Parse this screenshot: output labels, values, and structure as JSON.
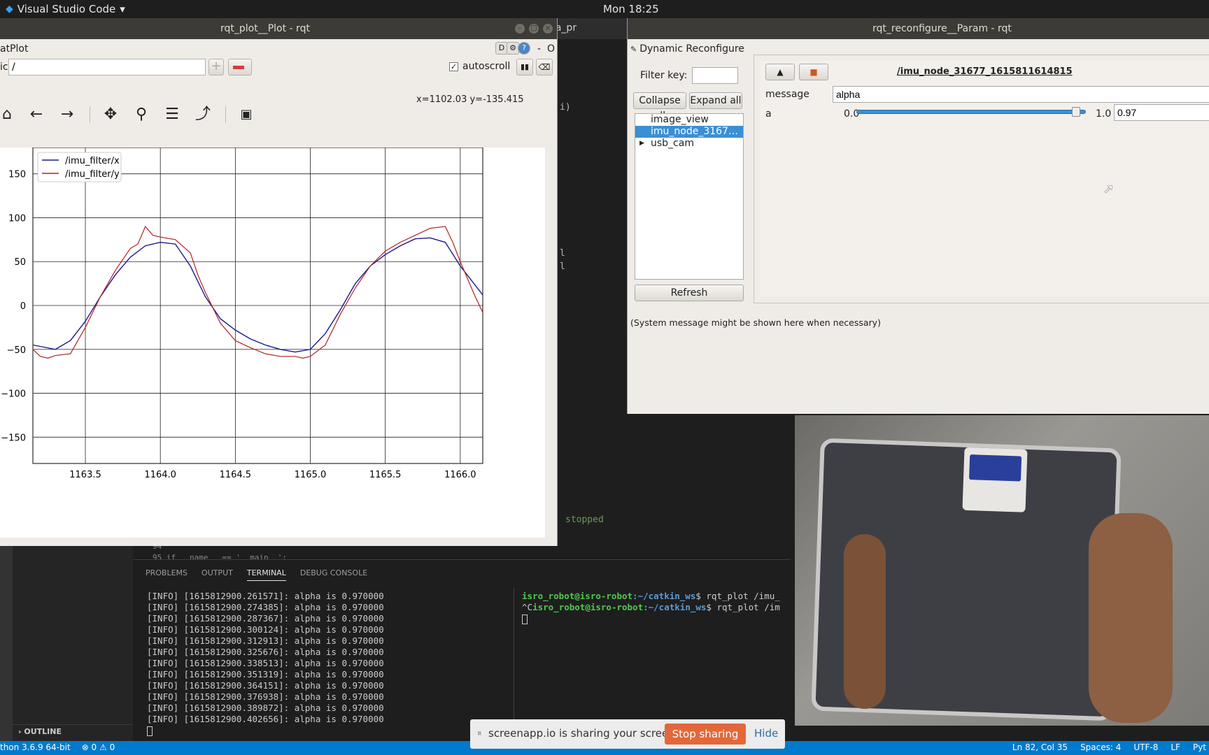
{
  "topbar": {
    "app": "Visual Studio Code",
    "app_caret": "▾",
    "clock": "Mon 18:25"
  },
  "vscode": {
    "tab_label": "- imu_data_pr",
    "code_fragments": [
      "i)",
      "l",
      "l",
      "stopped"
    ],
    "line_number": "94",
    "line_95": "95   if __name__ == '__main__':",
    "outline": "OUTLINE",
    "panel_tabs": [
      "PROBLEMS",
      "OUTPUT",
      "TERMINAL",
      "DEBUG CONSOLE"
    ],
    "terminal_left": [
      "[INFO] [1615812900.261571]: alpha is 0.970000",
      "[INFO] [1615812900.274385]: alpha is 0.970000",
      "[INFO] [1615812900.287367]: alpha is 0.970000",
      "[INFO] [1615812900.300124]: alpha is 0.970000",
      "[INFO] [1615812900.312913]: alpha is 0.970000",
      "[INFO] [1615812900.325676]: alpha is 0.970000",
      "[INFO] [1615812900.338513]: alpha is 0.970000",
      "[INFO] [1615812900.351319]: alpha is 0.970000",
      "[INFO] [1615812900.364151]: alpha is 0.970000",
      "[INFO] [1615812900.376938]: alpha is 0.970000",
      "[INFO] [1615812900.389872]: alpha is 0.970000",
      "[INFO] [1615812900.402656]: alpha is 0.970000"
    ],
    "terminal_right": {
      "user": "isro_robot@isro-robot",
      "path": ":~/catkin_ws",
      "cmd1": "$ rqt_plot /imu_",
      "prefix2": "^C",
      "cmd2": "$ rqt_plot /im"
    }
  },
  "statusbar": {
    "python": "thon 3.6.9 64-bit",
    "problems": "⊗ 0 ⚠ 0",
    "ln_col": "Ln 82, Col 35",
    "spaces": "Spaces: 4",
    "encoding": "UTF-8",
    "eol": "LF",
    "lang": "Pyt"
  },
  "plot_window": {
    "title": "rqt_plot__Plot - rqt",
    "plugin_name": "atPlot",
    "help_letter": "D",
    "topic_label": "ic",
    "topic_value": "/",
    "autoscroll_label": "autoscroll",
    "autoscroll_checked": true,
    "coords": "x=1102.03    y=-135.415",
    "toolbar_icons": [
      "home-icon",
      "back-arrow-icon",
      "forward-arrow-icon",
      "pan-icon",
      "zoom-icon",
      "configure-subplots-icon",
      "edit-axis-icon",
      "save-icon"
    ]
  },
  "chart_data": {
    "type": "line",
    "xlim": [
      1163.15,
      1566.15
    ],
    "x_ticks": [
      1163.5,
      1164.0,
      1164.5,
      1165.0,
      1165.5,
      1166.0
    ],
    "x_tick_labels": [
      "1163.5",
      "1164.0",
      "1164.5",
      "1165.0",
      "1165.5",
      "1166.0"
    ],
    "ylim": [
      -180,
      180
    ],
    "y_ticks": [
      150,
      100,
      50,
      0,
      -50,
      -100,
      -150
    ],
    "y_tick_labels": [
      "150",
      "100",
      "50",
      "0",
      "−50",
      "−100",
      "−150"
    ],
    "grid": true,
    "legend_position": "top-left",
    "series": [
      {
        "name": "/imu_filter/x",
        "color": "#1a1a8c",
        "x": [
          1163.15,
          1163.3,
          1163.4,
          1163.5,
          1163.6,
          1163.7,
          1163.8,
          1163.9,
          1164.0,
          1164.1,
          1164.2,
          1164.3,
          1164.4,
          1164.5,
          1164.6,
          1164.7,
          1164.8,
          1164.9,
          1165.0,
          1165.1,
          1165.2,
          1165.3,
          1165.4,
          1165.5,
          1165.6,
          1165.7,
          1165.8,
          1165.9,
          1166.0,
          1166.15
        ],
        "y": [
          -45,
          -50,
          -40,
          -18,
          10,
          35,
          55,
          68,
          72,
          70,
          45,
          10,
          -15,
          -28,
          -38,
          -45,
          -50,
          -53,
          -50,
          -32,
          -5,
          25,
          45,
          58,
          68,
          76,
          77,
          72,
          45,
          12
        ]
      },
      {
        "name": "/imu_filter/y",
        "color": "#b22222",
        "x": [
          1163.15,
          1163.2,
          1163.25,
          1163.3,
          1163.4,
          1163.45,
          1163.5,
          1163.6,
          1163.7,
          1163.8,
          1163.85,
          1163.9,
          1163.95,
          1164.0,
          1164.1,
          1164.2,
          1164.25,
          1164.3,
          1164.4,
          1164.5,
          1164.6,
          1164.7,
          1164.8,
          1164.9,
          1164.95,
          1165.0,
          1165.1,
          1165.2,
          1165.3,
          1165.4,
          1165.5,
          1165.6,
          1165.7,
          1165.8,
          1165.9,
          1165.95,
          1166.0,
          1166.05,
          1166.1,
          1166.15
        ],
        "y": [
          -50,
          -58,
          -60,
          -57,
          -55,
          -40,
          -25,
          10,
          40,
          65,
          70,
          90,
          80,
          78,
          75,
          60,
          35,
          15,
          -20,
          -40,
          -48,
          -55,
          -58,
          -58,
          -60,
          -58,
          -45,
          -10,
          20,
          45,
          62,
          72,
          80,
          88,
          90,
          72,
          50,
          30,
          10,
          -8
        ]
      }
    ]
  },
  "reconfigure_window": {
    "title": "rqt_reconfigure__Param - rqt",
    "plugin_name": "Dynamic Reconfigure",
    "filter_label": "Filter key:",
    "filter_value": "",
    "collapse_label": "Collapse all",
    "expand_label": "Expand all",
    "nodes": [
      {
        "label": "image_view",
        "selected": false,
        "expandable": false
      },
      {
        "label": "imu_node_3167…",
        "selected": true,
        "expandable": false
      },
      {
        "label": "usb_cam",
        "selected": false,
        "expandable": true
      }
    ],
    "refresh_label": "Refresh",
    "node_header": "/imu_node_31677_1615811614815",
    "params": {
      "message_label": "message",
      "message_value": "alpha",
      "a_label": "a",
      "a_min": "0.0",
      "a_max": "1.0",
      "a_value": "0.97",
      "a_fraction": 0.97
    },
    "system_message": "(System message might be shown here when necessary)"
  },
  "share_banner": {
    "text": "screenapp.io is sharing your screen.",
    "stop_label": "Stop sharing",
    "hide_label": "Hide"
  }
}
